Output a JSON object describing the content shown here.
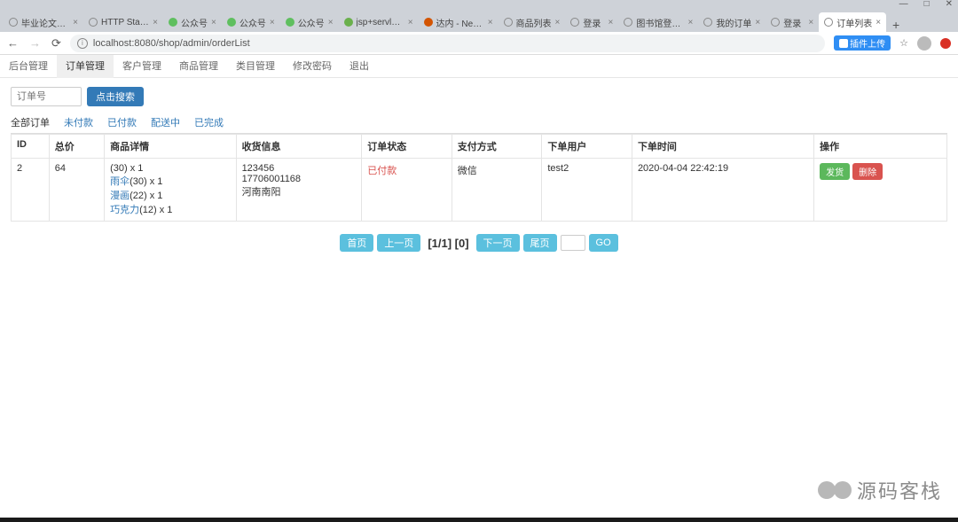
{
  "window": {
    "minimize": "—",
    "maximize": "□",
    "close": "✕"
  },
  "browser": {
    "tabs": [
      {
        "title": "毕业论文整…",
        "favicon": "globe",
        "color": "#777"
      },
      {
        "title": "HTTP Stat…",
        "favicon": "globe",
        "color": "#777"
      },
      {
        "title": "公众号",
        "favicon": "wechat",
        "color": "#5fbf5f"
      },
      {
        "title": "公众号",
        "favicon": "wechat",
        "color": "#5fbf5f"
      },
      {
        "title": "公众号",
        "favicon": "wechat",
        "color": "#5fbf5f"
      },
      {
        "title": "jsp+servle…",
        "favicon": "dot",
        "color": "#6ab04c"
      },
      {
        "title": "达内 - Net…",
        "favicon": "flag",
        "color": "#d35400"
      },
      {
        "title": "商品列表",
        "favicon": "globe",
        "color": "#777"
      },
      {
        "title": "登录",
        "favicon": "globe",
        "color": "#777"
      },
      {
        "title": "图书馆登录…",
        "favicon": "globe",
        "color": "#777"
      },
      {
        "title": "我的订单",
        "favicon": "globe",
        "color": "#777"
      },
      {
        "title": "登录",
        "favicon": "globe",
        "color": "#777"
      },
      {
        "title": "订单列表",
        "favicon": "globe",
        "color": "#777",
        "active": true
      }
    ],
    "url": "localhost:8080/shop/admin/orderList",
    "badge": "插件上传",
    "star": "☆"
  },
  "menu": {
    "items": [
      "后台管理",
      "订单管理",
      "客户管理",
      "商品管理",
      "类目管理",
      "修改密码",
      "退出"
    ],
    "activeIndex": 1
  },
  "search": {
    "placeholder": "订单号",
    "button": "点击搜索"
  },
  "filters": {
    "items": [
      "全部订单",
      "未付款",
      "已付款",
      "配送中",
      "已完成"
    ],
    "activeIndex": 0
  },
  "table": {
    "headers": [
      "ID",
      "总价",
      "商品详情",
      "收货信息",
      "订单状态",
      "支付方式",
      "下单用户",
      "下单时间",
      "操作"
    ],
    "row": {
      "id": "2",
      "total": "64",
      "goods": [
        {
          "name": "",
          "rest": "(30) x 1"
        },
        {
          "name": "雨伞",
          "rest": "(30) x 1"
        },
        {
          "name": "漫画",
          "rest": "(22) x 1"
        },
        {
          "name": "巧克力",
          "rest": "(12) x 1"
        }
      ],
      "ship": [
        "123456",
        "17706001168",
        "河南南阳"
      ],
      "status": "已付款",
      "pay": "微信",
      "user": "test2",
      "time": "2020-04-04 22:42:19",
      "actions": {
        "send": "发货",
        "del": "删除"
      }
    }
  },
  "pager": {
    "first": "首页",
    "prev": "上一页",
    "info": "[1/1] [0]",
    "next": "下一页",
    "last": "尾页",
    "go": "GO"
  },
  "watermark": "源码客栈"
}
